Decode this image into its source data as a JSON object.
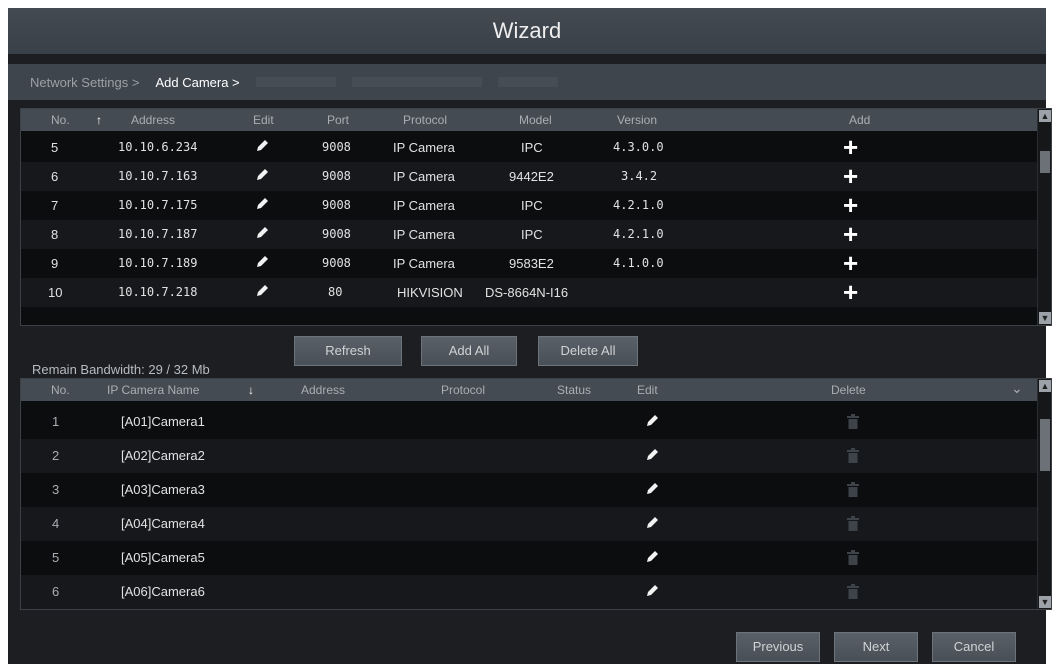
{
  "window": {
    "title": "Wizard"
  },
  "breadcrumb": [
    {
      "label": "Network Settings >",
      "state": "done"
    },
    {
      "label": "Add Camera >",
      "state": "active"
    },
    {
      "label": "",
      "state": "future"
    },
    {
      "label": "",
      "state": "future"
    },
    {
      "label": "",
      "state": "future"
    }
  ],
  "search_table": {
    "headers": {
      "no": "No.",
      "sort_icon": "↑",
      "address": "Address",
      "edit": "Edit",
      "port": "Port",
      "protocol": "Protocol",
      "model": "Model",
      "version": "Version",
      "add": "Add"
    },
    "rows": [
      {
        "no": "5",
        "address": "10.10.6.234",
        "port": "9008",
        "protocol": "IP Camera",
        "model": "IPC",
        "version": "4.3.0.0"
      },
      {
        "no": "6",
        "address": "10.10.7.163",
        "port": "9008",
        "protocol": "IP Camera",
        "model": "9442E2",
        "version": "3.4.2"
      },
      {
        "no": "7",
        "address": "10.10.7.175",
        "port": "9008",
        "protocol": "IP Camera",
        "model": "IPC",
        "version": "4.2.1.0"
      },
      {
        "no": "8",
        "address": "10.10.7.187",
        "port": "9008",
        "protocol": "IP Camera",
        "model": "IPC",
        "version": "4.2.1.0"
      },
      {
        "no": "9",
        "address": "10.10.7.189",
        "port": "9008",
        "protocol": "IP Camera",
        "model": "9583E2",
        "version": "4.1.0.0"
      },
      {
        "no": "10",
        "address": "10.10.7.218",
        "port": "80",
        "protocol": "HIKVISION",
        "model": "DS-8664N-I16",
        "version": ""
      }
    ]
  },
  "bandwidth": "Remain Bandwidth: 29 / 32 Mb",
  "actions": {
    "refresh": "Refresh",
    "add_all": "Add All",
    "delete_all": "Delete All"
  },
  "added_table": {
    "headers": {
      "no": "No.",
      "name": "IP Camera Name",
      "sort_icon": "↓",
      "address": "Address",
      "protocol": "Protocol",
      "status": "Status",
      "edit": "Edit",
      "delete": "Delete",
      "menu_icon": "⌄"
    },
    "rows": [
      {
        "no": "1",
        "name": "[A01]Camera1"
      },
      {
        "no": "2",
        "name": "[A02]Camera2"
      },
      {
        "no": "3",
        "name": "[A03]Camera3"
      },
      {
        "no": "4",
        "name": "[A04]Camera4"
      },
      {
        "no": "5",
        "name": "[A05]Camera5"
      },
      {
        "no": "6",
        "name": "[A06]Camera6"
      }
    ]
  },
  "footer": {
    "previous": "Previous",
    "next": "Next",
    "cancel": "Cancel"
  },
  "icons": {
    "add": "plus-icon",
    "edit": "pencil-icon",
    "delete": "trash-icon"
  }
}
